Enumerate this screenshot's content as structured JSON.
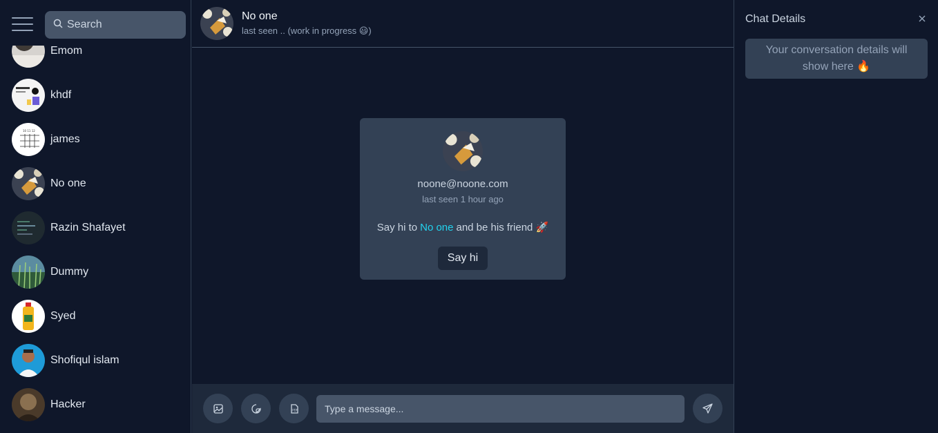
{
  "sidebar": {
    "search_placeholder": "Search",
    "contacts": [
      {
        "name": "Emom",
        "avatar": "photo"
      },
      {
        "name": "khdf",
        "avatar": "document"
      },
      {
        "name": "james",
        "avatar": "calendar"
      },
      {
        "name": "No one",
        "avatar": "bread"
      },
      {
        "name": "Razin Shafayet",
        "avatar": "code"
      },
      {
        "name": "Dummy",
        "avatar": "grass"
      },
      {
        "name": "Syed",
        "avatar": "bottle"
      },
      {
        "name": "Shofiqul islam",
        "avatar": "person"
      },
      {
        "name": "Hacker",
        "avatar": "dark-photo"
      }
    ]
  },
  "chat": {
    "name": "No one",
    "status": "last seen .. (work in progress 😃)",
    "welcome": {
      "email": "noone@noone.com",
      "last_seen": "last seen 1 hour ago",
      "say_prefix": "Say hi to",
      "say_name": "No one",
      "say_suffix": "and be his friend 🚀",
      "button": "Say hi"
    },
    "composer": {
      "placeholder": "Type a message...",
      "icons": [
        "image-icon",
        "sticker-icon",
        "file-icon",
        "send-icon"
      ]
    }
  },
  "details": {
    "title": "Chat Details",
    "placeholder": "Your conversation details will show here 🔥"
  },
  "colors": {
    "background": "#0f172a",
    "panel": "#334155",
    "accent": "#22d3ee"
  }
}
